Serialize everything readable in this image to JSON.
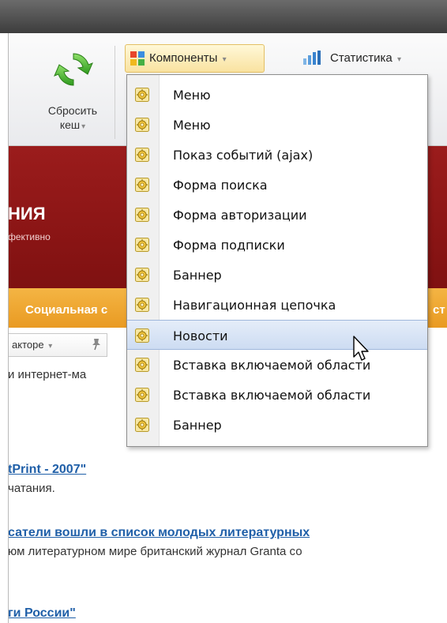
{
  "toolbar": {
    "reset_cache": {
      "label_line1": "Сбросить",
      "label_line2": "кеш"
    },
    "components": {
      "label": "Компоненты"
    },
    "statistics": {
      "label": "Статистика"
    },
    "dropdown_glyph": "▾"
  },
  "banner": {
    "title": "НИЯ",
    "subtitle": "фективно",
    "colors": {
      "background": "#8b1515",
      "nav": "#ec9f28"
    }
  },
  "navbar": {
    "left_text": "Социальная с",
    "right_text": "ст"
  },
  "editor": {
    "label": "акторе",
    "shop_text": "и интернет-ма"
  },
  "articles": [
    {
      "title": "tPrint - 2007\"",
      "desc": "чатания."
    },
    {
      "title": "сатели вошли в список молодых литературных",
      "desc": "юм литературном мире британский журнал Granta со"
    },
    {
      "title": "ги России\"",
      "desc": ""
    }
  ],
  "menu": {
    "items": [
      {
        "label": "Меню",
        "icon": "component-icon"
      },
      {
        "label": "Меню",
        "icon": "component-icon"
      },
      {
        "label": "Показ событий (ajax)",
        "icon": "component-icon"
      },
      {
        "label": "Форма поиска",
        "icon": "component-icon"
      },
      {
        "label": "Форма авторизации",
        "icon": "component-icon"
      },
      {
        "label": "Форма подписки",
        "icon": "component-icon"
      },
      {
        "label": "Баннер",
        "icon": "component-icon"
      },
      {
        "label": "Навигационная цепочка",
        "icon": "component-icon"
      },
      {
        "label": "Новости",
        "icon": "component-icon",
        "highlighted": true
      },
      {
        "label": "Вставка включаемой области",
        "icon": "component-icon"
      },
      {
        "label": "Вставка включаемой области",
        "icon": "component-icon"
      },
      {
        "label": "Баннер",
        "icon": "component-icon"
      }
    ]
  }
}
